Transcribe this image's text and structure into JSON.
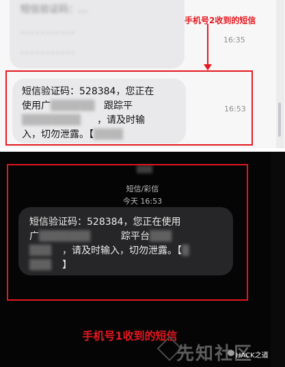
{
  "top_panel": {
    "msg1_line1": "短信验证码：…",
    "msg1_line2": "...........",
    "msg1_line3": "...........",
    "msg1_time": "16:35",
    "msg2_line1": "短信验证码：528384，您正在",
    "msg2_line2a": "使用广",
    "msg2_line2b": "跟踪平",
    "msg2_line3a": "请及时输",
    "msg2_line4a": "入，切勿泄露。【",
    "msg2_time": "16:53",
    "annotation": "手机号2收到的短信"
  },
  "bottom_panel": {
    "header_type": "短信/彩信",
    "header_time": "今天 16:53",
    "msg_line1": "短信验证码：528384，您正在使用",
    "msg_line2a": "广",
    "msg_line2b": "踪平台",
    "msg_line3": "，请及时输入，切勿泄露。【",
    "annotation": "手机号1收到的短信"
  },
  "watermark": {
    "site": "先知社区",
    "account": "HACK之道"
  }
}
